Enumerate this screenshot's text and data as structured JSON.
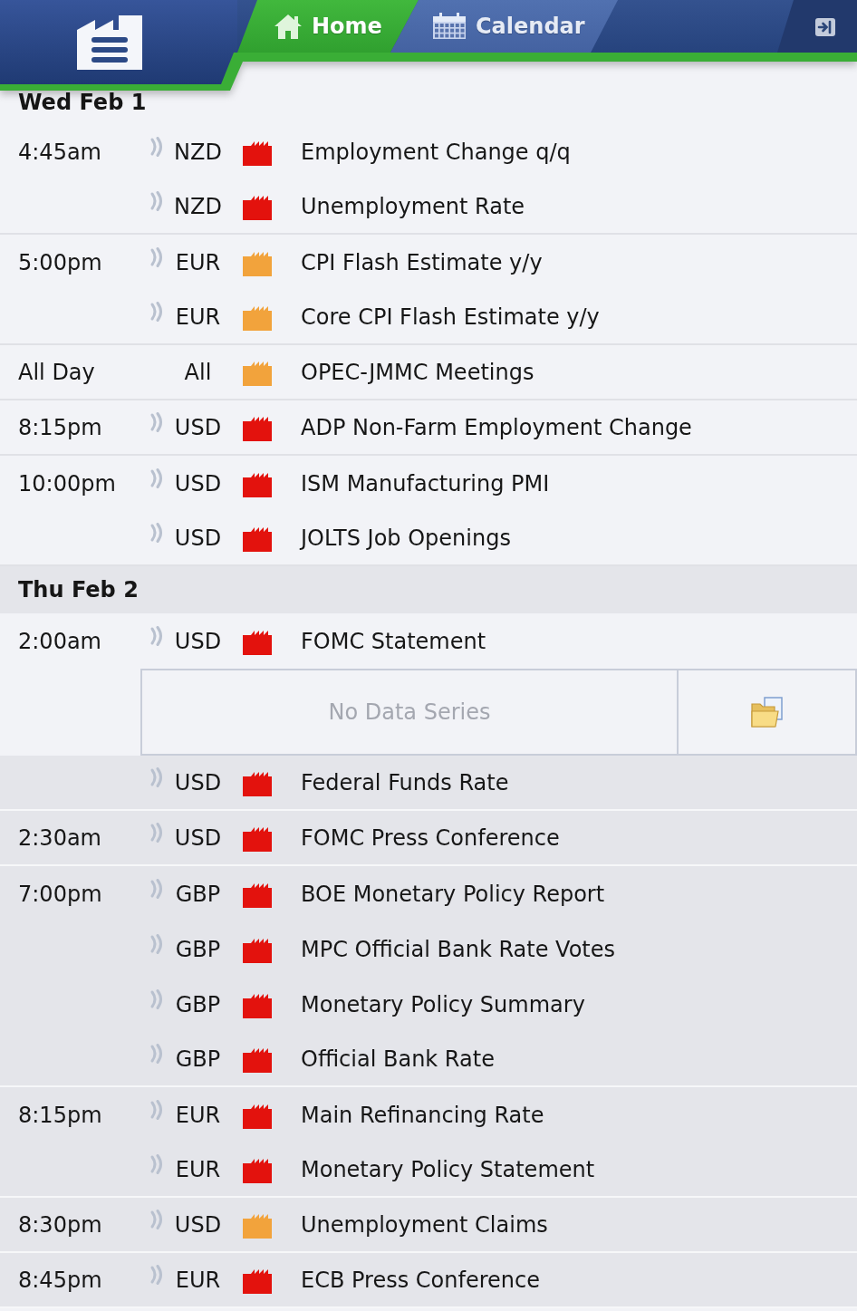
{
  "header": {
    "tabs": [
      {
        "label": "Home",
        "selected": true
      },
      {
        "label": "Calendar",
        "selected": false
      }
    ]
  },
  "days": [
    {
      "label": "Wed Feb 1",
      "shaded": false,
      "groups": [
        {
          "time": "4:45am",
          "events": [
            {
              "currency": "NZD",
              "alert": true,
              "color": "#e3120d",
              "title": "Employment Change q/q",
              "shaded": false
            },
            {
              "currency": "NZD",
              "alert": true,
              "color": "#e3120d",
              "title": "Unemployment Rate",
              "shaded": false
            }
          ]
        },
        {
          "time": "5:00pm",
          "events": [
            {
              "currency": "EUR",
              "alert": true,
              "color": "#f2a33c",
              "title": "CPI Flash Estimate y/y",
              "shaded": false
            },
            {
              "currency": "EUR",
              "alert": true,
              "color": "#f2a33c",
              "title": "Core CPI Flash Estimate y/y",
              "shaded": false
            }
          ]
        },
        {
          "time": "All Day",
          "events": [
            {
              "currency": "All",
              "alert": false,
              "color": "#f2a33c",
              "title": "OPEC-JMMC Meetings",
              "shaded": false
            }
          ]
        },
        {
          "time": "8:15pm",
          "events": [
            {
              "currency": "USD",
              "alert": true,
              "color": "#e3120d",
              "title": "ADP Non-Farm Employment Change",
              "shaded": false
            }
          ]
        },
        {
          "time": "10:00pm",
          "events": [
            {
              "currency": "USD",
              "alert": true,
              "color": "#e3120d",
              "title": "ISM Manufacturing PMI",
              "shaded": false
            },
            {
              "currency": "USD",
              "alert": true,
              "color": "#e3120d",
              "title": "JOLTS Job Openings",
              "shaded": false
            }
          ]
        }
      ]
    },
    {
      "label": "Thu Feb 2",
      "shaded": true,
      "groups": [
        {
          "time": "2:00am",
          "events": [
            {
              "currency": "USD",
              "alert": true,
              "color": "#e3120d",
              "title": "FOMC Statement",
              "shaded": false,
              "detail": {
                "message": "No Data Series"
              }
            },
            {
              "currency": "USD",
              "alert": true,
              "color": "#e3120d",
              "title": "Federal Funds Rate",
              "shaded": true
            }
          ]
        },
        {
          "time": "2:30am",
          "events": [
            {
              "currency": "USD",
              "alert": true,
              "color": "#e3120d",
              "title": "FOMC Press Conference",
              "shaded": true
            }
          ]
        },
        {
          "time": "7:00pm",
          "events": [
            {
              "currency": "GBP",
              "alert": true,
              "color": "#e3120d",
              "title": "BOE Monetary Policy Report",
              "shaded": true
            },
            {
              "currency": "GBP",
              "alert": true,
              "color": "#e3120d",
              "title": "MPC Official Bank Rate Votes",
              "shaded": true
            },
            {
              "currency": "GBP",
              "alert": true,
              "color": "#e3120d",
              "title": "Monetary Policy Summary",
              "shaded": true
            },
            {
              "currency": "GBP",
              "alert": true,
              "color": "#e3120d",
              "title": "Official Bank Rate",
              "shaded": true
            }
          ]
        },
        {
          "time": "8:15pm",
          "events": [
            {
              "currency": "EUR",
              "alert": true,
              "color": "#e3120d",
              "title": "Main Refinancing Rate",
              "shaded": true
            },
            {
              "currency": "EUR",
              "alert": true,
              "color": "#e3120d",
              "title": "Monetary Policy Statement",
              "shaded": true
            }
          ]
        },
        {
          "time": "8:30pm",
          "events": [
            {
              "currency": "USD",
              "alert": true,
              "color": "#f2a33c",
              "title": "Unemployment Claims",
              "shaded": true
            }
          ]
        },
        {
          "time": "8:45pm",
          "events": [
            {
              "currency": "EUR",
              "alert": true,
              "color": "#e3120d",
              "title": "ECB Press Conference",
              "shaded": true
            }
          ]
        }
      ]
    }
  ]
}
